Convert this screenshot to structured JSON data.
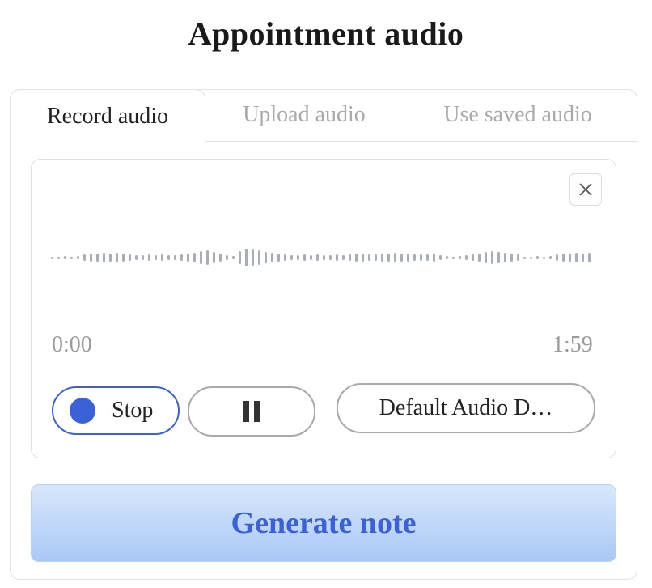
{
  "title": "Appointment audio",
  "tabs": [
    {
      "label": "Record audio",
      "active": true
    },
    {
      "label": "Upload audio",
      "active": false
    },
    {
      "label": "Use saved audio",
      "active": false
    }
  ],
  "recorder": {
    "time_start": "0:00",
    "time_end": "1:59",
    "stop_label": "Stop",
    "device_label": "Default Audio D…",
    "close_icon": "close-icon",
    "pause_icon": "pause-icon"
  },
  "actions": {
    "generate_label": "Generate note"
  },
  "colors": {
    "accent": "#3a62d6",
    "waveform": "#a8adb8",
    "generate_bg_top": "#d9e7fb",
    "generate_bg_bottom": "#a9c8f6"
  }
}
